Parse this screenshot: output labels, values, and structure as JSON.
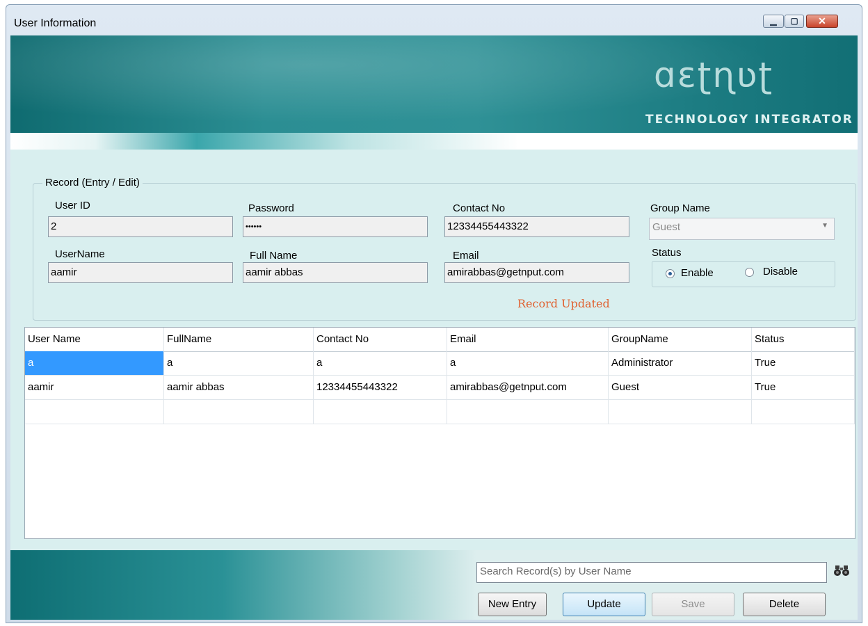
{
  "window": {
    "title": "User Information",
    "controls": {
      "minimize": "▁",
      "maximize": "▢",
      "close": "✕"
    }
  },
  "banner": {
    "logo_text": "ɑɛʈɳʋʈ",
    "logo_tagline": "TECHNOLOGY INTEGRATOR"
  },
  "form": {
    "group_label": "Record (Entry / Edit)",
    "user_id": {
      "label": "User ID",
      "value": "2"
    },
    "password": {
      "label": "Password",
      "value": "••••••"
    },
    "contact_no": {
      "label": "Contact No",
      "value": "12334455443322"
    },
    "group_name": {
      "label": "Group Name",
      "value": "Guest"
    },
    "username": {
      "label": "UserName",
      "value": "aamir"
    },
    "full_name": {
      "label": "Full Name",
      "value": "aamir abbas"
    },
    "email": {
      "label": "Email",
      "value": "amirabbas@getnput.com"
    },
    "status": {
      "label": "Status",
      "enable": "Enable",
      "disable": "Disable",
      "selected": "Enable"
    },
    "message": "Record Updated"
  },
  "grid": {
    "columns": [
      "User Name",
      "FullName",
      "Contact No",
      "Email",
      "GroupName",
      "Status"
    ],
    "rows": [
      [
        "a",
        "a",
        "a",
        "a",
        "Administrator",
        "True"
      ],
      [
        "aamir",
        "aamir abbas",
        "12334455443322",
        "amirabbas@getnput.com",
        "Guest",
        "True"
      ],
      [
        "",
        "",
        "",
        "",
        "",
        ""
      ]
    ]
  },
  "footer": {
    "search_placeholder": "Search Record(s) by User Name",
    "buttons": {
      "new_entry": "New Entry",
      "update": "Update",
      "save": "Save",
      "delete": "Delete"
    }
  },
  "colors": {
    "accent": "#3399ff",
    "message": "#e0602f",
    "banner": "#1d7d83",
    "background": "#d9efef"
  }
}
